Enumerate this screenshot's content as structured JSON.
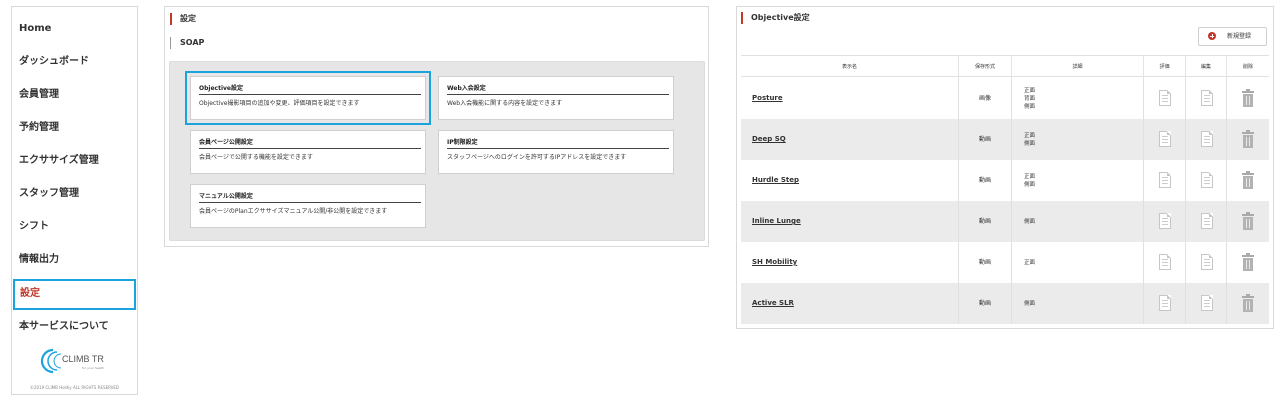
{
  "sidebar": {
    "items": [
      {
        "label": "Home"
      },
      {
        "label": "ダッシュボード"
      },
      {
        "label": "会員管理"
      },
      {
        "label": "予約管理"
      },
      {
        "label": "エクササイズ管理"
      },
      {
        "label": "スタッフ管理"
      },
      {
        "label": "シフト"
      },
      {
        "label": "情報出力"
      },
      {
        "label": "設定"
      },
      {
        "label": "本サービスについて"
      }
    ],
    "active_index": 8,
    "logo_text": "CLIMB TR",
    "logo_tagline": "for your health",
    "copyright": "©2019 CLIMB Holdiy ALL RIGHTS RESERVED"
  },
  "settings": {
    "title": "設定",
    "section": "SOAP",
    "cards": [
      {
        "title": "Objective設定",
        "desc": "Objective撮影項目の追加や変更、評価項目を設定できます",
        "highlighted": true
      },
      {
        "title": "Web入会設定",
        "desc": "Web入会機能に関する内容を設定できます",
        "highlighted": false
      },
      {
        "title": "会員ページ公開設定",
        "desc": "会員ページで公開する機能を設定できます",
        "highlighted": false
      },
      {
        "title": "IP制限設定",
        "desc": "スタッフページへのログインを許可するIPアドレスを設定できます",
        "highlighted": false
      },
      {
        "title": "マニュアル公開設定",
        "desc": "会員ページのPlanエクササイズマニュアル公開/非公開を設定できます",
        "highlighted": false
      }
    ]
  },
  "objective": {
    "title": "Objective設定",
    "new_button": "新規登録",
    "headers": {
      "name": "表示名",
      "format": "保存形式",
      "detail": "詳細",
      "eval": "評価",
      "edit": "編集",
      "delete": "削除"
    },
    "rows": [
      {
        "name": "Posture",
        "format": "画像",
        "details": [
          "正面",
          "背面",
          "側面"
        ]
      },
      {
        "name": "Deep SQ",
        "format": "動画",
        "details": [
          "正面",
          "側面"
        ]
      },
      {
        "name": "Hurdle Step",
        "format": "動画",
        "details": [
          "正面",
          "側面"
        ]
      },
      {
        "name": "Inline Lunge",
        "format": "動画",
        "details": [
          "側面"
        ]
      },
      {
        "name": "SH Mobility",
        "format": "動画",
        "details": [
          "正面"
        ]
      },
      {
        "name": "Active SLR",
        "format": "動画",
        "details": [
          "側面"
        ]
      }
    ]
  },
  "colors": {
    "accent": "#c0392b",
    "highlight": "#1aa3dc",
    "logo": "#1aa3dc"
  }
}
